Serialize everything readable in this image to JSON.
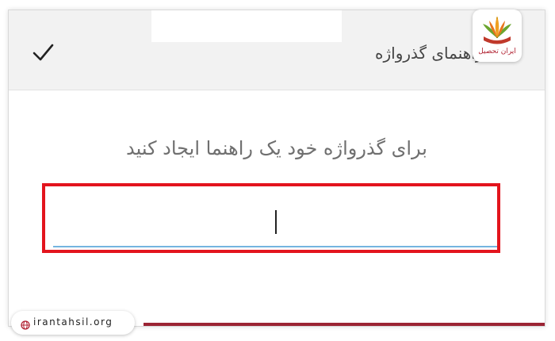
{
  "header": {
    "title": "راهنمای گذرواژه",
    "confirm_icon": "checkmark-icon"
  },
  "main": {
    "prompt": "برای گذرواژه خود یک راهنما ایجاد کنید",
    "hint_input_value": ""
  },
  "colors": {
    "highlight_outline": "#e3141d",
    "input_underline": "#74b4e0",
    "bottom_bar": "#9b2434"
  },
  "watermark": {
    "logo_text": "ایران تحصیل",
    "site": "irantahsil.org",
    "globe_icon": "globe-icon"
  }
}
